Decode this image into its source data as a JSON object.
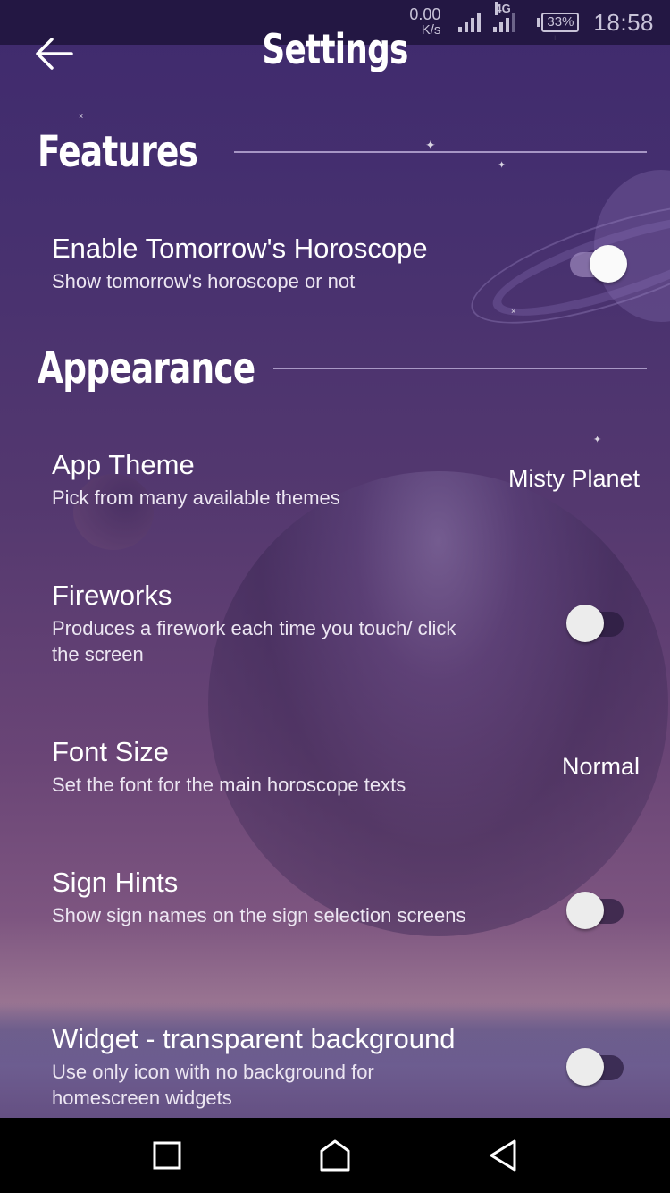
{
  "status_bar": {
    "net_speed": "0.00",
    "net_speed_unit": "K/s",
    "network_type": "4G",
    "battery": "33%",
    "time": "18:58"
  },
  "app_bar": {
    "title": "Settings",
    "back_icon": "arrow-left-icon"
  },
  "sections": [
    {
      "title": "Features",
      "items": [
        {
          "title": "Enable Tomorrow's Horoscope",
          "summary": "Show tomorrow's horoscope or not",
          "type": "toggle",
          "checked": true
        }
      ]
    },
    {
      "title": "Appearance",
      "items": [
        {
          "title": "App Theme",
          "summary": "Pick from many available themes",
          "type": "value",
          "value": "Misty Planet"
        },
        {
          "title": "Fireworks",
          "summary": "Produces a firework each time you touch/ click the screen",
          "type": "toggle",
          "checked": false
        },
        {
          "title": "Font Size",
          "summary": "Set the font for the main horoscope texts",
          "type": "value",
          "value": "Normal"
        },
        {
          "title": "Sign Hints",
          "summary": "Show sign names on the sign selection screens",
          "type": "toggle",
          "checked": false
        },
        {
          "title": "Widget - transparent background",
          "summary": "Use only icon with no background for homescreen widgets",
          "type": "toggle",
          "checked": false
        }
      ]
    }
  ],
  "nav_bar": {
    "recents_icon": "square-recents-icon",
    "home_icon": "home-icon",
    "back_icon": "triangle-back-icon"
  }
}
